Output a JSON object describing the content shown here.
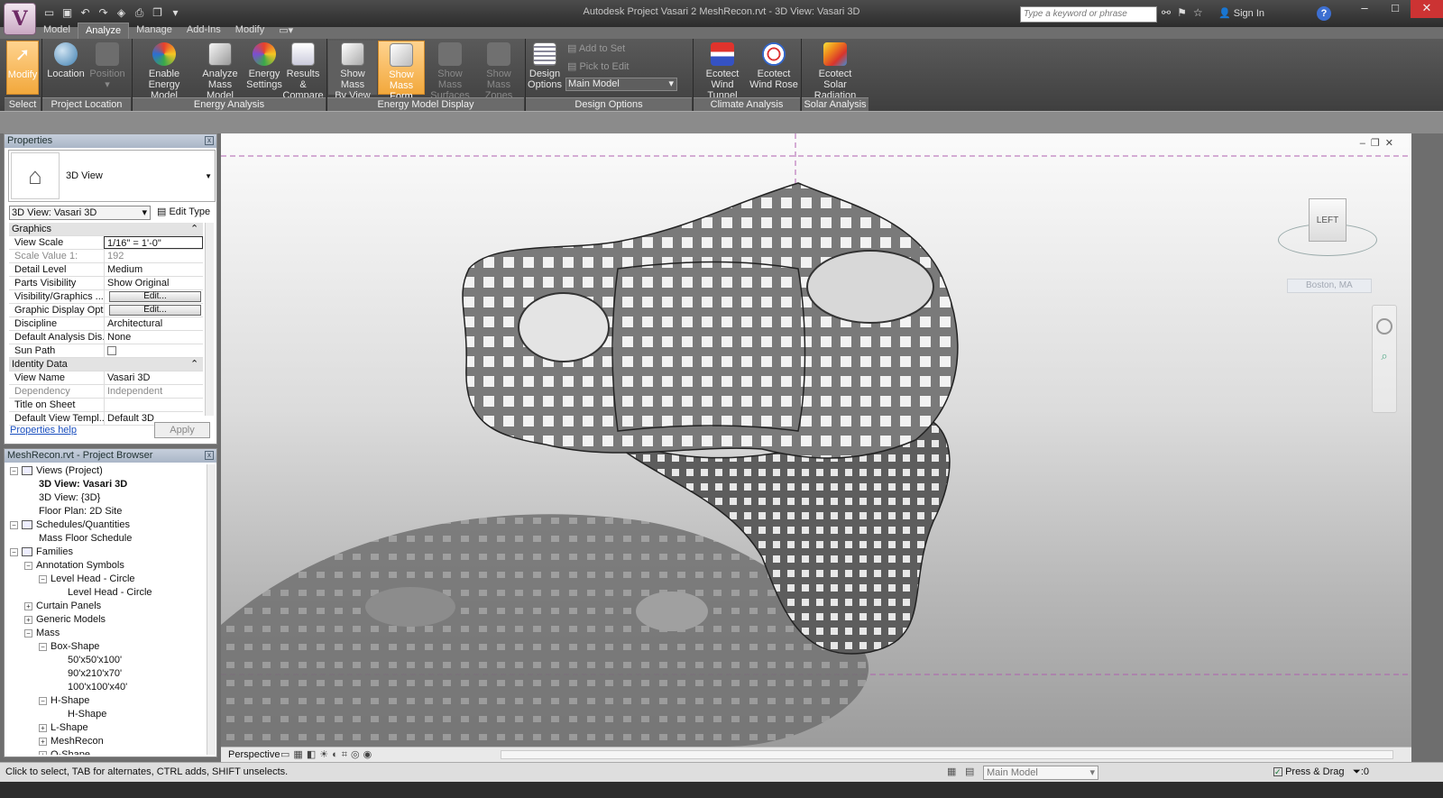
{
  "window": {
    "title": "Autodesk Project Vasari 2    MeshRecon.rvt - 3D View: Vasari 3D",
    "search_placeholder": "Type a keyword or phrase",
    "sign_in": "Sign In",
    "help": "?"
  },
  "ribbon": {
    "tabs": [
      "Model",
      "Analyze",
      "Manage",
      "Add-Ins",
      "Modify"
    ],
    "active_tab": "Analyze",
    "panels": {
      "select": {
        "title": "Select",
        "modify": "Modify"
      },
      "project_location": {
        "title": "Project Location",
        "location": "Location",
        "position": "Position"
      },
      "energy_analysis": {
        "title": "Energy Analysis",
        "enable_l1": "Enable Energy",
        "enable_l2": "Model",
        "analyze_l1": "Analyze",
        "analyze_l2": "Mass Model",
        "settings_l1": "Energy",
        "settings_l2": "Settings",
        "results_l1": "Results &",
        "results_l2": "Compare"
      },
      "energy_model_display": {
        "title": "Energy Model Display",
        "by_view_l1": "Show Mass",
        "by_view_l2": "By View",
        "form_l1": "Show Mass",
        "form_l2": "Form",
        "surfaces_l1": "Show Mass",
        "surfaces_l2": "Surfaces",
        "zones_l1": "Show Mass",
        "zones_l2": "Zones"
      },
      "design_options": {
        "title": "Design Options",
        "design_l1": "Design",
        "design_l2": "Options",
        "add_to_set": "Add to Set",
        "pick_to_edit": "Pick to Edit",
        "main_model": "Main Model"
      },
      "climate_analysis": {
        "title": "Climate Analysis",
        "tunnel_l1": "Ecotect",
        "tunnel_l2": "Wind Tunnel",
        "rose_l1": "Ecotect",
        "rose_l2": "Wind Rose"
      },
      "solar_analysis": {
        "title": "Solar Analysis",
        "solar_l1": "Ecotect",
        "solar_l2": "Solar Radiation"
      }
    }
  },
  "properties": {
    "title": "Properties",
    "type_name": "3D View",
    "view_selector": "3D View: Vasari 3D",
    "edit_type": "Edit Type",
    "groups": {
      "graphics": "Graphics",
      "identity": "Identity Data"
    },
    "rows": [
      {
        "key": "View Scale",
        "value": "1/16\" = 1'-0\""
      },
      {
        "key": "Scale Value    1:",
        "value": "192"
      },
      {
        "key": "Detail Level",
        "value": "Medium"
      },
      {
        "key": "Parts Visibility",
        "value": "Show Original"
      },
      {
        "key": "Visibility/Graphics ...",
        "value": "Edit..."
      },
      {
        "key": "Graphic Display Opt...",
        "value": "Edit..."
      },
      {
        "key": "Discipline",
        "value": "Architectural"
      },
      {
        "key": "Default Analysis Dis...",
        "value": "None"
      },
      {
        "key": "Sun Path",
        "value": ""
      }
    ],
    "identity_rows": [
      {
        "key": "View Name",
        "value": "Vasari 3D"
      },
      {
        "key": "Dependency",
        "value": "Independent"
      },
      {
        "key": "Title on Sheet",
        "value": ""
      },
      {
        "key": "Default View Templ...",
        "value": "Default 3D"
      }
    ],
    "help_link": "Properties help",
    "apply": "Apply"
  },
  "browser": {
    "title": "MeshRecon.rvt - Project Browser",
    "items": [
      {
        "label": "Views (Project)",
        "level": 0,
        "toggle": "−",
        "icon": true
      },
      {
        "label": "3D View: Vasari 3D",
        "level": 2,
        "bold": true
      },
      {
        "label": "3D View: {3D}",
        "level": 2
      },
      {
        "label": "Floor Plan: 2D Site",
        "level": 2
      },
      {
        "label": "Schedules/Quantities",
        "level": 0,
        "toggle": "−",
        "icon": true
      },
      {
        "label": "Mass Floor Schedule",
        "level": 2
      },
      {
        "label": "Families",
        "level": 0,
        "toggle": "−",
        "icon": true
      },
      {
        "label": "Annotation Symbols",
        "level": 1,
        "toggle": "−"
      },
      {
        "label": "Level Head - Circle",
        "level": 2,
        "toggle": "−"
      },
      {
        "label": "Level Head - Circle",
        "level": 4
      },
      {
        "label": "Curtain Panels",
        "level": 1,
        "toggle": "+"
      },
      {
        "label": "Generic Models",
        "level": 1,
        "toggle": "+"
      },
      {
        "label": "Mass",
        "level": 1,
        "toggle": "−"
      },
      {
        "label": "Box-Shape",
        "level": 2,
        "toggle": "−"
      },
      {
        "label": "50'x50'x100'",
        "level": 4
      },
      {
        "label": "90'x210'x70'",
        "level": 4
      },
      {
        "label": "100'x100'x40'",
        "level": 4
      },
      {
        "label": "H-Shape",
        "level": 2,
        "toggle": "−"
      },
      {
        "label": "H-Shape",
        "level": 4
      },
      {
        "label": "L-Shape",
        "level": 2,
        "toggle": "+"
      },
      {
        "label": "MeshRecon",
        "level": 2,
        "toggle": "+"
      },
      {
        "label": "O-Shape",
        "level": 2,
        "toggle": "+"
      }
    ]
  },
  "viewport": {
    "viewcube_face": "LEFT",
    "location": "Boston, MA",
    "view_mode": "Perspective"
  },
  "status": {
    "message": "Click to select, TAB for alternates, CTRL adds, SHIFT unselects.",
    "model": "Main Model",
    "press_drag": "Press & Drag",
    "filter": ":0"
  },
  "colors": {
    "accent": "#f2a83c",
    "ribbon": "#4a4a4a",
    "titlebar": "#2c2c2c"
  }
}
